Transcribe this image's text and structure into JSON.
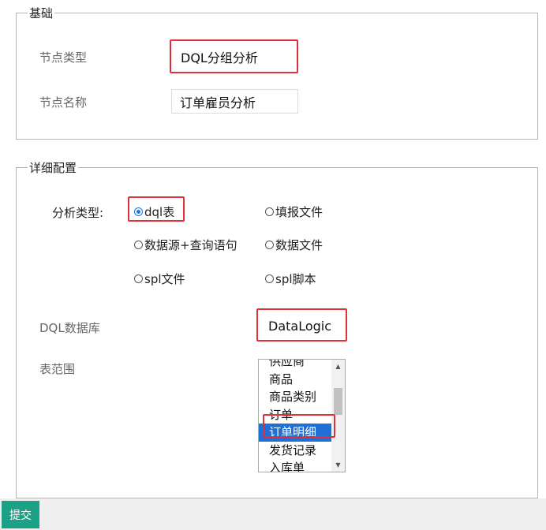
{
  "basic": {
    "legend": "基础",
    "node_type_label": "节点类型",
    "node_type_value": "DQL分组分析",
    "node_name_label": "节点名称",
    "node_name_value": "订单雇员分析"
  },
  "detail": {
    "legend": "详细配置",
    "analysis_type_label": "分析类型:",
    "radios": [
      {
        "label": "dql表",
        "checked": true
      },
      {
        "label": "填报文件",
        "checked": false
      },
      {
        "label": "数据源+查询语句",
        "checked": false
      },
      {
        "label": "数据文件",
        "checked": false
      },
      {
        "label": "spl文件",
        "checked": false
      },
      {
        "label": "spl脚本",
        "checked": false
      }
    ],
    "dql_db_label": "DQL数据库",
    "dql_db_value": "DataLogic",
    "table_scope_label": "表范围",
    "table_items": [
      "供应商",
      "商品",
      "商品类别",
      "订单",
      "订单明细",
      "发货记录",
      "入库单"
    ],
    "selected_table": "订单明细",
    "highlight_color": "#e0303a",
    "selection_color": "#1f6fd6"
  },
  "footer": {
    "submit_label": "提交",
    "button_color": "#1aa186"
  }
}
